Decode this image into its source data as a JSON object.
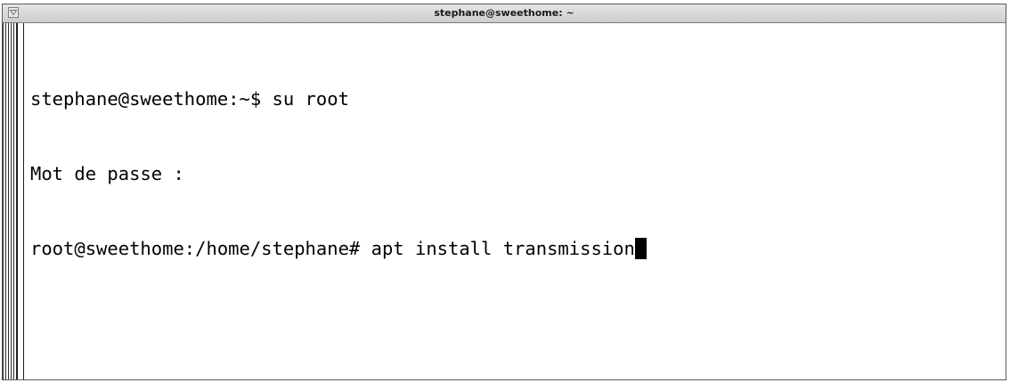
{
  "window": {
    "title": "stephane@sweethome: ~",
    "menu_icon": "triangle-down-icon"
  },
  "terminal": {
    "lines": [
      "stephane@sweethome:~$ su root",
      "Mot de passe :",
      "root@sweethome:/home/stephane# apt install transmission"
    ],
    "colors": {
      "background": "#ffffff",
      "foreground": "#000000",
      "cursor": "#000000"
    }
  }
}
